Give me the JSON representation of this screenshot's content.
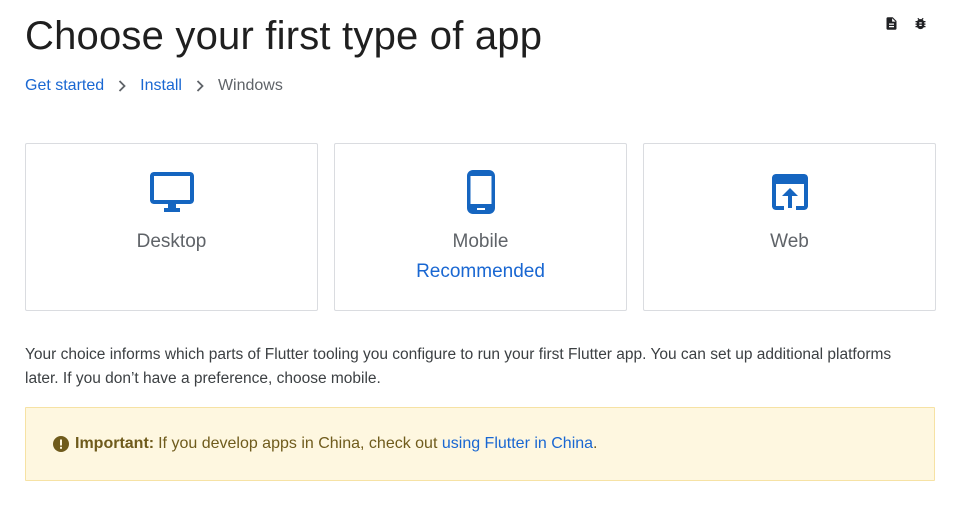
{
  "header": {
    "title": "Choose your first type of app",
    "actions": [
      {
        "icon": "document-icon"
      },
      {
        "icon": "bug-icon"
      }
    ]
  },
  "breadcrumb": {
    "items": [
      {
        "label": "Get started",
        "link": true
      },
      {
        "label": "Install",
        "link": true
      },
      {
        "label": "Windows",
        "link": false
      }
    ]
  },
  "cards": [
    {
      "icon": "desktop-icon",
      "label": "Desktop",
      "sublabel": ""
    },
    {
      "icon": "mobile-icon",
      "label": "Mobile",
      "sublabel": "Recommended"
    },
    {
      "icon": "web-icon",
      "label": "Web",
      "sublabel": ""
    }
  ],
  "description": "Your choice informs which parts of Flutter tooling you configure to run your first Flutter app. You can set up additional platforms later. If you don’t have a preference, choose mobile.",
  "callout": {
    "icon": "important-icon",
    "heading": "Important:",
    "text": "If you develop apps in China, check out",
    "link_text": "using Flutter in China",
    "suffix": "."
  },
  "colors": {
    "accent": "#1967d2",
    "callout_bg": "#fef7e0",
    "callout_text": "#6f5b1c",
    "icon_blue": "#1565c0"
  }
}
